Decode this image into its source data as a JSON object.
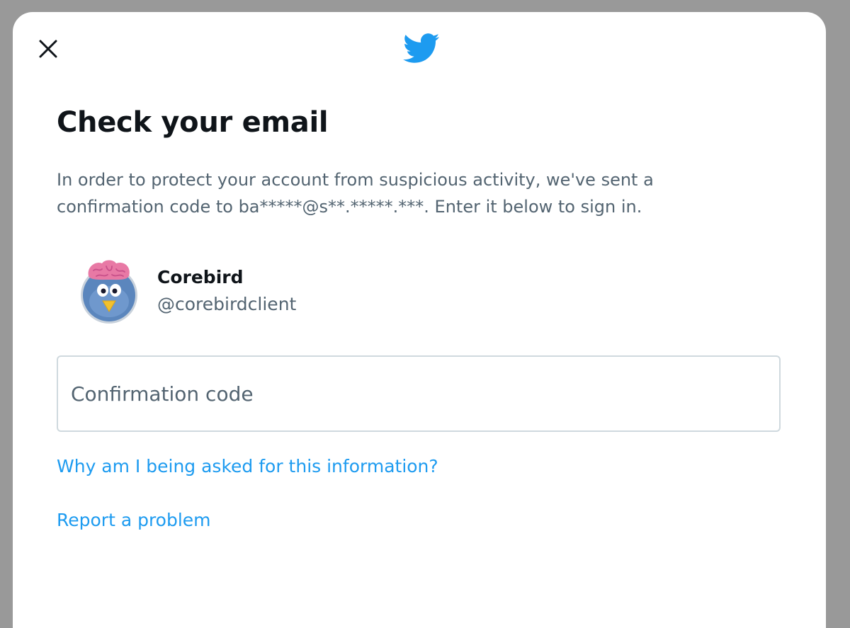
{
  "dialog": {
    "title": "Check your email",
    "description": "In order to protect your account from suspicious activity, we've sent a confirmation code to ba*****@s**.*****.***. Enter it below to sign in.",
    "close_icon": "close-icon",
    "logo_icon": "twitter-bird-icon"
  },
  "account": {
    "name": "Corebird",
    "handle": "@corebirdclient",
    "avatar_icon": "corebird-avatar"
  },
  "code_input": {
    "placeholder": "Confirmation code",
    "value": ""
  },
  "links": {
    "why_label": "Why am I being asked for this information?",
    "report_label": "Report a problem"
  },
  "colors": {
    "accent": "#1d9bf0",
    "text_primary": "#0f1419",
    "text_secondary": "#536471",
    "backdrop": "#999999"
  }
}
